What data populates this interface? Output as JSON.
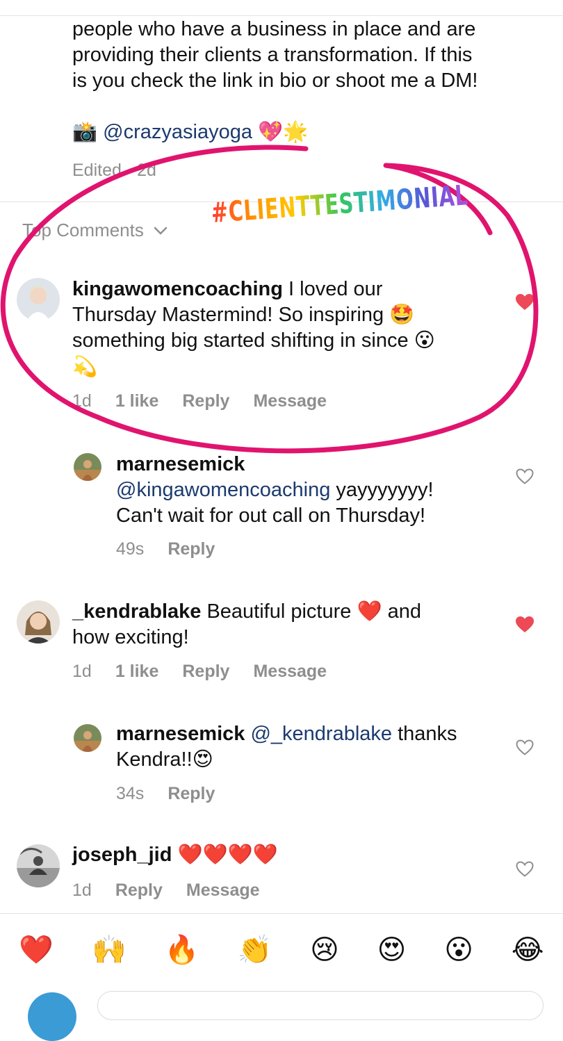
{
  "caption": {
    "lines": [
      "people who have a business in place and are",
      "providing their clients a transformation.  If this",
      "is you check the link in bio or shoot me a DM!"
    ],
    "camera_emoji": "📸",
    "mention": "@crazyasiayoga",
    "trail_emojis": "💖🌟",
    "edited": "Edited · 2d"
  },
  "top_comments_label": "Top Comments",
  "sticker_text": "#CLIENTTESTIMONIAL",
  "sticker_colors": [
    "#ff3b30",
    "#ff9500",
    "#ffcc00",
    "#34c759",
    "#32ade6",
    "#5856d6",
    "#af52de"
  ],
  "annotation_color": "#e0146e",
  "comments": [
    {
      "username": "kingawomencoaching",
      "text_1": " I loved our",
      "text_2": "Thursday Mastermind! So inspiring 🤩",
      "text_3": "something big started shifting in since 😮",
      "text_4": "💫",
      "time": "1d",
      "likes": "1 like",
      "reply": "Reply",
      "message": "Message",
      "liked": true
    },
    {
      "username": "marnesemick",
      "mention": "@kingawomencoaching",
      "text_1": " yayyyyyyy!",
      "text_2": "Can't wait for out call on Thursday!",
      "time": "49s",
      "reply": "Reply",
      "liked": false
    },
    {
      "username": "_kendrablake",
      "text_1": " Beautiful picture ❤️  and",
      "text_2": "how exciting!",
      "time": "1d",
      "likes": "1 like",
      "reply": "Reply",
      "message": "Message",
      "liked": true
    },
    {
      "username": "marnesemick",
      "mention": "@_kendrablake",
      "text_1": " thanks",
      "text_2": "Kendra!!😍",
      "time": "34s",
      "reply": "Reply",
      "liked": false
    },
    {
      "username": "joseph_jid",
      "text_1": " ❤️❤️❤️❤️",
      "time": "1d",
      "reply": "Reply",
      "message": "Message",
      "liked": false
    }
  ],
  "reactions": [
    "❤️",
    "🙌",
    "🔥",
    "👏",
    "😢",
    "😍",
    "😮",
    "😂"
  ],
  "colors": {
    "liked_heart": "#ed4956",
    "muted_text": "#8e8e8e",
    "mention": "#1b3a6e"
  }
}
